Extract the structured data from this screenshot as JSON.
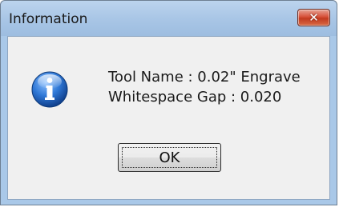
{
  "window": {
    "title": "Information",
    "close_glyph": "✕"
  },
  "dialog": {
    "icon": "information-icon",
    "lines": [
      "Tool Name : 0.02\" Engrave",
      "Whitespace Gap : 0.020"
    ],
    "ok_label": "OK"
  },
  "colors": {
    "titlebar": "#a9c6e6",
    "client_bg": "#f0f0f0",
    "close_button": "#c94a30",
    "info_icon": "#1c5fb8"
  }
}
